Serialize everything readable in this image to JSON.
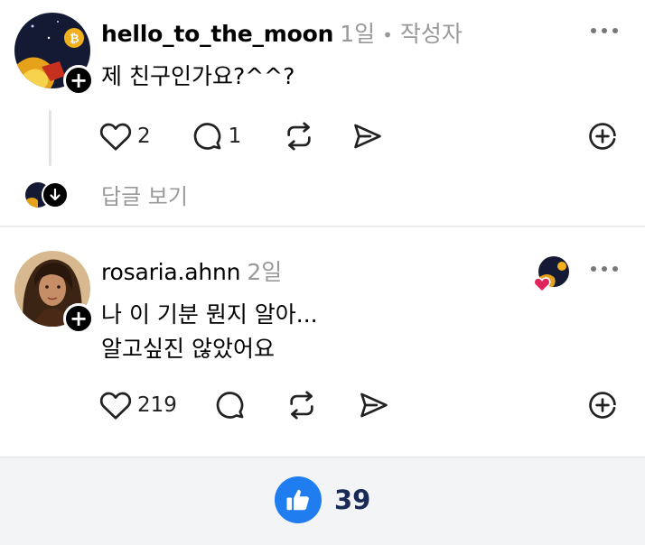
{
  "posts": [
    {
      "username": "hello_to_the_moon",
      "time": "1일",
      "separator": "•",
      "author_tag": "작성자",
      "text_lines": [
        "제 친구인가요?^^?"
      ],
      "likes": "2",
      "comments": "1",
      "replies_link": "답글 보기"
    },
    {
      "username": "rosaria.ahnn",
      "time": "2일",
      "text_lines": [
        "나 이 기분 뭔지 알아...",
        "알고싶진 않았어요"
      ],
      "likes": "219"
    }
  ],
  "footer": {
    "like_count": "39"
  },
  "icons": {
    "more": "more-horizontal-icon",
    "heart": "heart-icon",
    "comment": "comment-icon",
    "repost": "repost-icon",
    "share": "send-icon",
    "save": "add-circle-icon",
    "follow": "plus-icon",
    "thumbs_up": "thumbs-up-icon",
    "down_arrow": "arrow-down-icon"
  },
  "colors": {
    "accent": "#1f7df0",
    "muted": "#999999",
    "like_red": "#e0245e"
  }
}
